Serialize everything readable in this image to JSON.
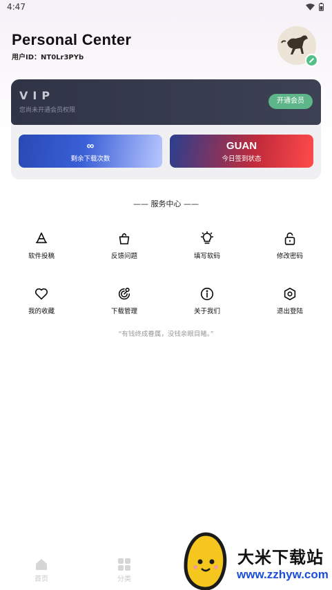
{
  "status": {
    "time": "4:47"
  },
  "header": {
    "title": "Personal Center",
    "user_id": "用户ID：NT0Lr3PYb"
  },
  "vip": {
    "title": "VIP",
    "subtitle": "您尚未开通会员权限",
    "button": "开通会员"
  },
  "stats": [
    {
      "value": "∞",
      "label": "剩余下载次数"
    },
    {
      "value": "GUAN",
      "label": "今日签到状态"
    }
  ],
  "services": {
    "title": "—— 服务中心 ——",
    "items": [
      {
        "label": "软件投稿",
        "icon": "app-store-icon"
      },
      {
        "label": "反馈问题",
        "icon": "feedback-icon"
      },
      {
        "label": "填写软码",
        "icon": "lightbulb-icon"
      },
      {
        "label": "修改密码",
        "icon": "lock-icon"
      },
      {
        "label": "我的收藏",
        "icon": "heart-icon"
      },
      {
        "label": "下载管理",
        "icon": "download-manage-icon"
      },
      {
        "label": "关于我们",
        "icon": "info-icon"
      },
      {
        "label": "退出登陆",
        "icon": "hexagon-settings-icon"
      }
    ]
  },
  "quote": "“有钱终成眷属，没钱亲眼目睹。”",
  "tabbar": [
    {
      "label": "首页",
      "icon": "home-icon"
    },
    {
      "label": "分类",
      "icon": "grid-icon"
    }
  ],
  "watermark": {
    "name": "大米下载站",
    "url": "www.zzhyw.com"
  }
}
